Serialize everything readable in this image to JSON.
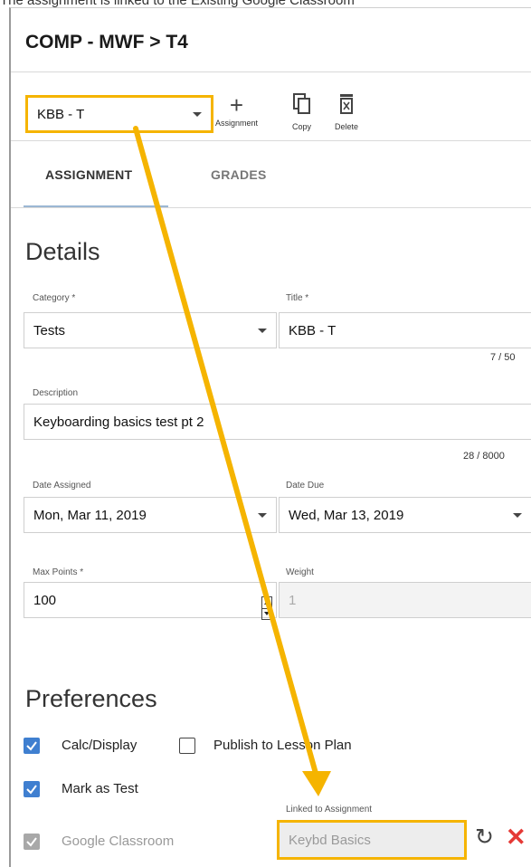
{
  "caption": "The assignment is linked to the Existing Google Classroom",
  "header": {
    "title": "COMP - MWF > T4"
  },
  "toolbar": {
    "assignment_select": "KBB - T",
    "add_label": "Assignment",
    "copy_label": "Copy",
    "delete_label": "Delete"
  },
  "tabs": [
    {
      "label": "ASSIGNMENT",
      "active": true
    },
    {
      "label": "GRADES",
      "active": false
    }
  ],
  "details": {
    "title": "Details",
    "category": {
      "label": "Category *",
      "value": "Tests"
    },
    "title_field": {
      "label": "Title *",
      "value": "KBB - T",
      "counter": "7 / 50"
    },
    "description": {
      "label": "Description",
      "value": "Keyboarding basics test pt 2",
      "counter": "28 / 8000"
    },
    "date_assigned": {
      "label": "Date Assigned",
      "value": "Mon, Mar 11, 2019"
    },
    "date_due": {
      "label": "Date Due",
      "value": "Wed, Mar 13, 2019"
    },
    "max_points": {
      "label": "Max Points *",
      "value": "100"
    },
    "weight": {
      "label": "Weight",
      "value": "1"
    }
  },
  "preferences": {
    "title": "Preferences",
    "calc_display": {
      "label": "Calc/Display",
      "checked": true
    },
    "publish_lesson_plan": {
      "label": "Publish to Lesson Plan",
      "checked": false
    },
    "mark_as_test": {
      "label": "Mark as Test",
      "checked": true
    },
    "google_classroom": {
      "label": "Google Classroom",
      "checked": true,
      "disabled": true
    },
    "linked": {
      "label": "Linked to Assignment",
      "value": "Keybd Basics"
    }
  },
  "colors": {
    "highlight": "#f5b400",
    "checkbox": "#3f7fd0",
    "close": "#e53935"
  },
  "icons": [
    "plus-icon",
    "copy-icon",
    "trash-icon",
    "chevron-down-icon",
    "refresh-icon",
    "close-icon",
    "check-icon",
    "arrow-annotation"
  ]
}
